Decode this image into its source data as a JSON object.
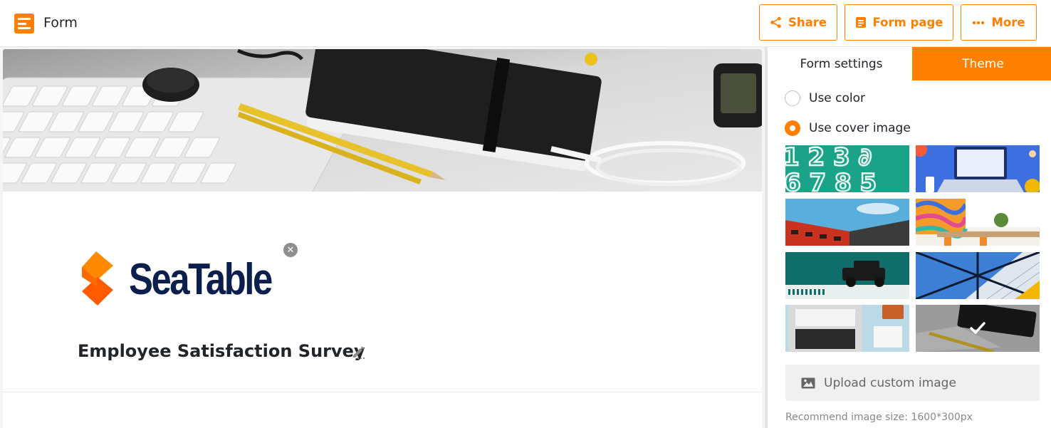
{
  "app": {
    "title": "Form",
    "logo_icon": "form-app-icon"
  },
  "toolbar": {
    "share_label": "Share",
    "form_page_label": "Form page",
    "more_label": "More",
    "accent_color": "#ff8000"
  },
  "form": {
    "logo_text": "SeaTable",
    "title": "Employee Satisfaction Survey",
    "cover_image": "desk-with-keyboard-notebook-pencil"
  },
  "panel": {
    "tabs": [
      {
        "label": "Form settings",
        "active": false
      },
      {
        "label": "Theme",
        "active": true
      }
    ],
    "options": {
      "use_color": {
        "label": "Use color",
        "checked": false
      },
      "use_cover_image": {
        "label": "Use cover image",
        "checked": true
      }
    },
    "cover_images": [
      {
        "name": "numbers-green",
        "selected": false
      },
      {
        "name": "laptop-illustration-blue",
        "selected": false
      },
      {
        "name": "red-building-sky",
        "selected": false
      },
      {
        "name": "office-colorful-wall",
        "selected": false
      },
      {
        "name": "vintage-car-teal",
        "selected": false
      },
      {
        "name": "glass-skyscraper",
        "selected": false
      },
      {
        "name": "laptop-desk-top-view",
        "selected": false
      },
      {
        "name": "desk-keyboard-notebook",
        "selected": true
      }
    ],
    "upload_label": "Upload custom image",
    "hint": "Recommend image size: 1600*300px"
  }
}
